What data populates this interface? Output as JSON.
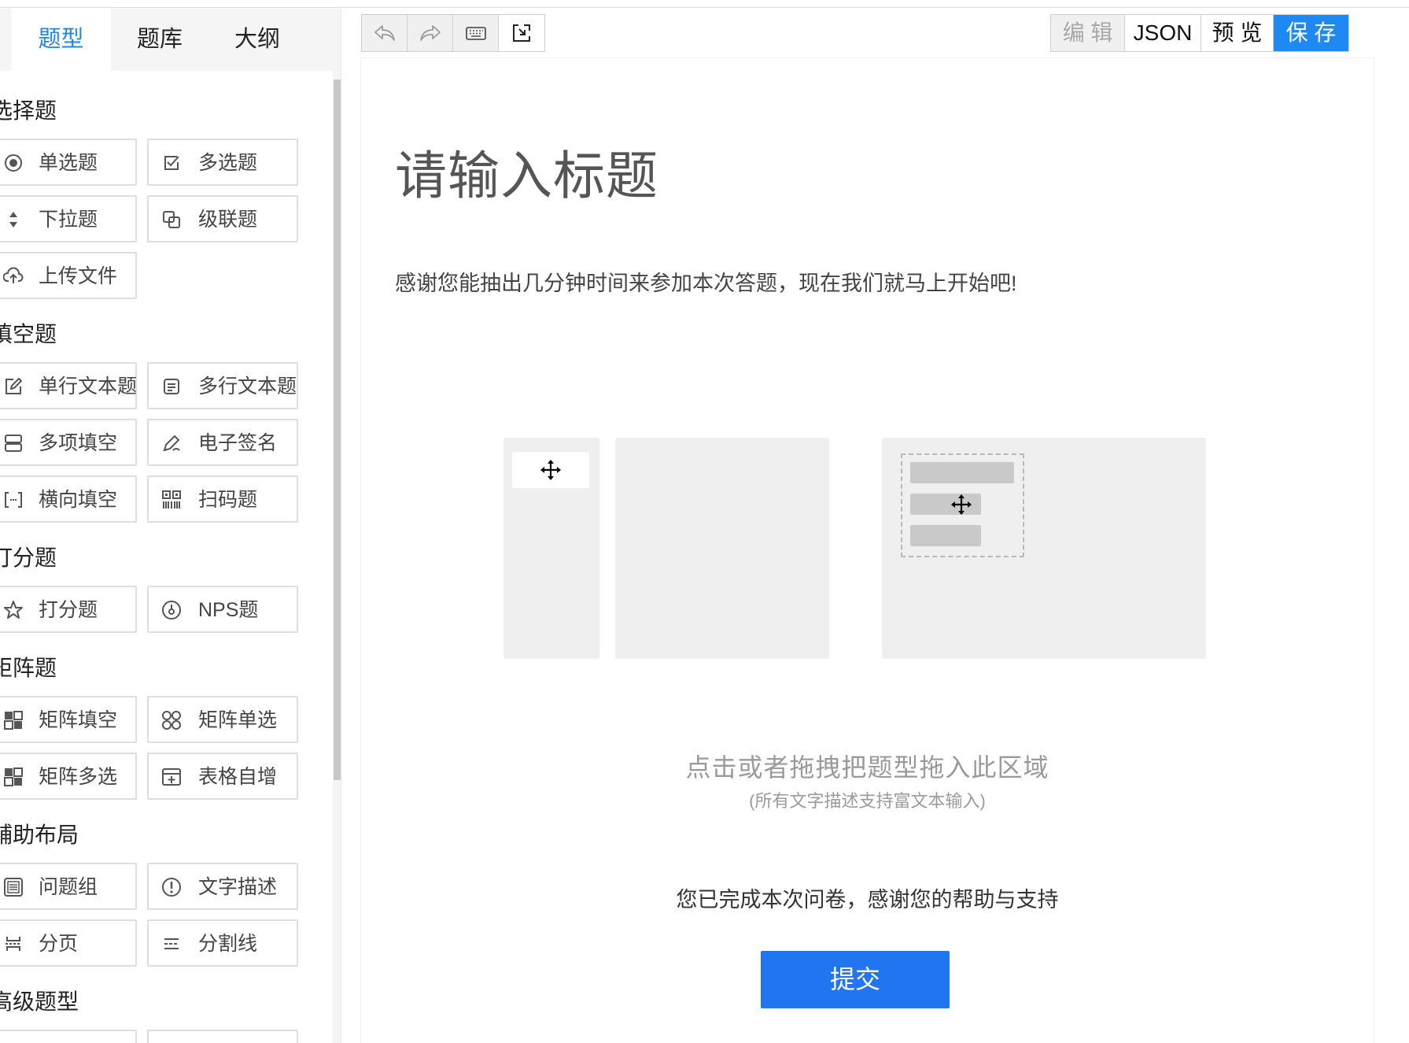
{
  "tabs": [
    {
      "label": "题型",
      "active": true
    },
    {
      "label": "题库",
      "active": false
    },
    {
      "label": "大纲",
      "active": false
    }
  ],
  "sections": {
    "choice": {
      "title": "选择题",
      "items": [
        {
          "label": "单选题",
          "icon": "radio-icon"
        },
        {
          "label": "多选题",
          "icon": "checkbox-icon"
        },
        {
          "label": "下拉题",
          "icon": "sort-icon"
        },
        {
          "label": "级联题",
          "icon": "cascade-icon"
        },
        {
          "label": "上传文件",
          "icon": "upload-cloud-icon"
        }
      ]
    },
    "fill": {
      "title": "填空题",
      "items": [
        {
          "label": "单行文本题",
          "icon": "edit-icon"
        },
        {
          "label": "多行文本题",
          "icon": "multiline-text-icon"
        },
        {
          "label": "多项填空",
          "icon": "multi-field-icon"
        },
        {
          "label": "电子签名",
          "icon": "signature-pen-icon"
        },
        {
          "label": "横向填空",
          "icon": "inline-blank-icon"
        },
        {
          "label": "扫码题",
          "icon": "qrcode-icon"
        }
      ]
    },
    "score": {
      "title": "打分题",
      "items": [
        {
          "label": "打分题",
          "icon": "star-icon"
        },
        {
          "label": "NPS题",
          "icon": "nps-icon"
        }
      ]
    },
    "matrix": {
      "title": "矩阵题",
      "items": [
        {
          "label": "矩阵填空",
          "icon": "matrix-fill-icon"
        },
        {
          "label": "矩阵单选",
          "icon": "matrix-radio-icon"
        },
        {
          "label": "矩阵多选",
          "icon": "matrix-checkbox-icon"
        },
        {
          "label": "表格自增",
          "icon": "table-add-icon"
        }
      ]
    },
    "layout": {
      "title": "辅助布局",
      "items": [
        {
          "label": "问题组",
          "icon": "question-group-icon"
        },
        {
          "label": "文字描述",
          "icon": "info-circle-icon"
        },
        {
          "label": "分页",
          "icon": "page-break-icon"
        },
        {
          "label": "分割线",
          "icon": "divider-icon"
        }
      ]
    },
    "advanced": {
      "title": "高级题型"
    }
  },
  "toolbar": {
    "icons": [
      "undo-icon",
      "redo-icon",
      "keyboard-icon",
      "import-icon"
    ]
  },
  "modes": {
    "edit": "编 辑",
    "json": "JSON",
    "preview": "预 览",
    "save": "保 存"
  },
  "survey": {
    "title": "请输入标题",
    "description": "感谢您能抽出几分钟时间来参加本次答题，现在我们就马上开始吧!",
    "drop_hint": "点击或者拖拽把题型拖入此区域",
    "drop_subhint": "(所有文字描述支持富文本输入)",
    "completion": "您已完成本次问卷，感谢您的帮助与支持",
    "submit_label": "提交"
  },
  "colors": {
    "accent": "#1e88e5",
    "primary_button": "#1e88f5",
    "submit_button": "#2175f0",
    "panel": "#efefef"
  }
}
